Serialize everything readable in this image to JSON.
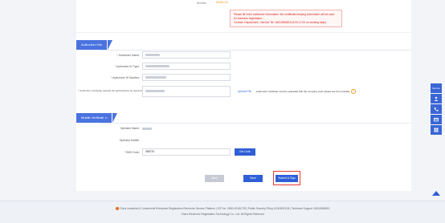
{
  "top_section": {
    "label": "Mobile:",
    "value": "2023-14",
    "notice_line1": "Please fill in the authorizer information: the certificate-keeping information will be used for business registration...",
    "notice_line2": "Contact: Department - Service Tel: 18210566815 (9:00-17:00 on working days)"
  },
  "authorizer_section": {
    "title": "Authorizer Info",
    "fields": [
      {
        "label": "Authorizer Name:",
        "required": true,
        "value": ""
      },
      {
        "label": "Authorizer ID Type:",
        "required": true,
        "value": ""
      },
      {
        "label": "Authorizer ID Number:",
        "required": true,
        "value": ""
      },
      {
        "label": "Authorizer Certificate (upload the authorization as required):",
        "required": true,
        "value": ""
      }
    ],
    "upload_link": "Upload File",
    "upload_hint": "Authorizer certificate must be uploaded with the company seal; please see the template.",
    "help_icon": "question-circle-icon"
  },
  "mobile_section": {
    "title": "Mobile Verification",
    "name_label": "Operator Name:",
    "name_value": "",
    "phone_label": "Operator Mobile:",
    "phone_value": "",
    "code_label": "SMS Code:",
    "code_value": "085720",
    "sms_button": "Get Code"
  },
  "actions": {
    "back": "Back",
    "save": "Save",
    "submit": "Submit & Sign"
  },
  "footer": {
    "line1": "China Industrial & Commercial Enterprise Registration Electronic Service Platform | ICP No. 0800-20181793 | Public Security Filing 11010802126 | Technical Support 18210566815",
    "line2": "China Electronic Registration Technology Co., Ltd. All Rights Reserved"
  },
  "side_bar": {
    "items": [
      {
        "label": "Service",
        "icon": "service-icon"
      },
      {
        "label": "",
        "icon": "user-icon"
      },
      {
        "label": "",
        "icon": "phone-icon"
      },
      {
        "label": "",
        "icon": "mail-icon"
      },
      {
        "label": "",
        "icon": "grid-icon"
      }
    ]
  },
  "colors": {
    "accent": "#2f5fd6",
    "highlight": "#e53935",
    "notice": "#d9261c"
  }
}
